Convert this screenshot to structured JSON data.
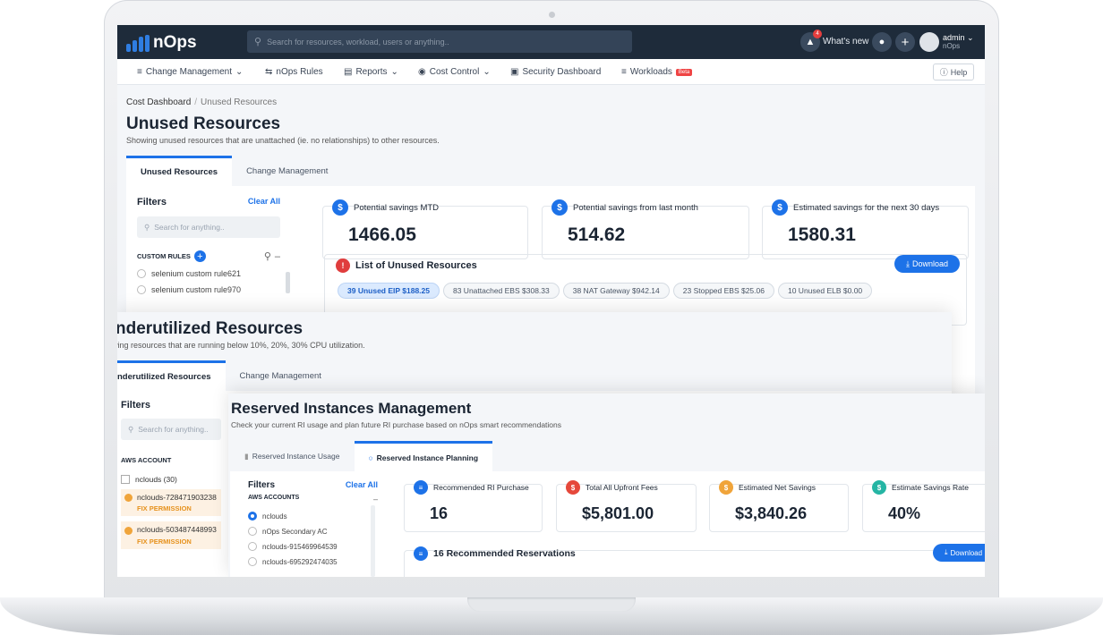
{
  "topbar": {
    "logo": "nOps",
    "search_placeholder": "Search for resources, workload, users or anything..",
    "notif_count": "4",
    "whats_new": "What's new",
    "user_name": "admin",
    "user_org": "nOps"
  },
  "menu": {
    "items": [
      "Change Management",
      "nOps Rules",
      "Reports",
      "Cost Control",
      "Security Dashboard",
      "Workloads"
    ],
    "beta": "Beta",
    "help": "Help"
  },
  "unused": {
    "breadcrumb_root": "Cost Dashboard",
    "breadcrumb_sep": "/",
    "breadcrumb_current": "Unused Resources",
    "title": "Unused Resources",
    "subtitle": "Showing unused resources that are unattached (ie. no relationships) to other resources.",
    "tabs": [
      "Unused Resources",
      "Change Management"
    ],
    "filters_title": "Filters",
    "clear_all": "Clear All",
    "filter_search_placeholder": "Search for anything..",
    "custom_rules_label": "CUSTOM RULES",
    "rules": [
      "selenium custom rule621",
      "selenium custom rule970"
    ],
    "cards": [
      {
        "label": "Potential savings MTD",
        "value": "1466.05"
      },
      {
        "label": "Potential savings from last month",
        "value": "514.62"
      },
      {
        "label": "Estimated savings for the next 30 days",
        "value": "1580.31"
      }
    ],
    "list_title": "List of Unused Resources",
    "download": "Download",
    "pills": [
      "39 Unused EIP $188.25",
      "83 Unattached EBS $308.33",
      "38 NAT Gateway $942.14",
      "23 Stopped EBS $25.06",
      "10 Unused ELB $0.00"
    ]
  },
  "underutilized": {
    "title": "nderutilized Resources",
    "subtitle": "wing resources that are running below 10%, 20%, 30% CPU utilization.",
    "tabs": [
      "nderutilized Resources",
      "Change Management"
    ],
    "filters_title": "Filters",
    "filter_search_placeholder": "Search for anything..",
    "aws_account_label": "AWS ACCOUNT",
    "accounts": [
      {
        "name": "nclouds (30)",
        "warn": false
      },
      {
        "name": "nclouds-728471903238",
        "warn": true,
        "fix": "FIX PERMISSION"
      },
      {
        "name": "nclouds-503487448993",
        "warn": true,
        "fix": "FIX PERMISSION"
      }
    ]
  },
  "reserved": {
    "title": "Reserved Instances Management",
    "subtitle": "Check your current RI usage and plan future RI purchase based on nOps smart recommendations",
    "tabs": [
      "Reserved Instance Usage",
      "Reserved Instance Planning"
    ],
    "filters_title": "Filters",
    "clear_all": "Clear All",
    "aws_accounts_label": "AWS ACCOUNTS",
    "accounts": [
      "nclouds",
      "nOps Secondary AC",
      "nclouds-915469964539",
      "nclouds-695292474035"
    ],
    "cards": [
      {
        "label": "Recommended RI Purchase",
        "value": "16",
        "color": "#1d72e8"
      },
      {
        "label": "Total All Upfront Fees",
        "value": "$5,801.00",
        "color": "#e5483b"
      },
      {
        "label": "Estimated Net Savings",
        "value": "$3,840.26",
        "color": "#f0a43a"
      },
      {
        "label": "Estimate Savings Rate",
        "value": "40%",
        "color": "#25b5a4"
      }
    ],
    "recs_title": "16 Recommended Reservations",
    "download": "Download"
  },
  "colors": {
    "accent": "#1d72e8",
    "topbar": "#1e2b3a",
    "danger": "#e03d3d",
    "warning": "#f0a43a"
  }
}
